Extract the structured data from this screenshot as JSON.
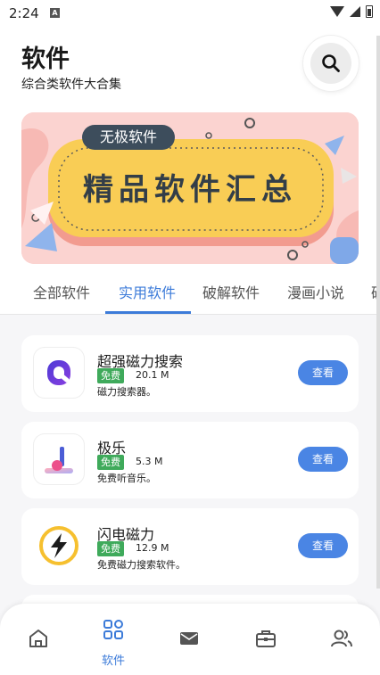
{
  "status_bar": {
    "time": "2:24",
    "notification_icon": "A"
  },
  "header": {
    "title": "软件",
    "subtitle": "综合类软件大合集",
    "search_icon": "search-icon"
  },
  "banner": {
    "tag": "无极软件",
    "headline": "精品软件汇总",
    "colors": {
      "background": "#fbd3d0",
      "plate": "#f9cd55",
      "tag": "#3d4d5c"
    }
  },
  "tabs": [
    {
      "label": "全部软件",
      "active": false
    },
    {
      "label": "实用软件",
      "active": true
    },
    {
      "label": "破解软件",
      "active": false
    },
    {
      "label": "漫画小说",
      "active": false
    },
    {
      "label": "破",
      "active": false
    }
  ],
  "apps": [
    {
      "name": "超强磁力搜索",
      "badge": "免费",
      "size": "20.1 M",
      "desc": "磁力搜索器。",
      "button": "查看",
      "icon": "q-logo-icon"
    },
    {
      "name": "极乐",
      "badge": "免费",
      "size": "5.3 M",
      "desc": "免费听音乐。",
      "button": "查看",
      "icon": "music-note-icon"
    },
    {
      "name": "闪电磁力",
      "badge": "免费",
      "size": "12.9 M",
      "desc": "免费磁力搜索软件。",
      "button": "查看",
      "icon": "lightning-icon"
    }
  ],
  "bottom_nav": [
    {
      "icon": "home-icon",
      "label": ""
    },
    {
      "icon": "apps-grid-icon",
      "label": "软件",
      "active": true
    },
    {
      "icon": "mail-icon",
      "label": ""
    },
    {
      "icon": "toolbox-icon",
      "label": ""
    },
    {
      "icon": "users-icon",
      "label": ""
    }
  ],
  "colors": {
    "accent": "#3c7bd9",
    "button": "#4a85e4",
    "free_badge": "#3faa5b"
  }
}
